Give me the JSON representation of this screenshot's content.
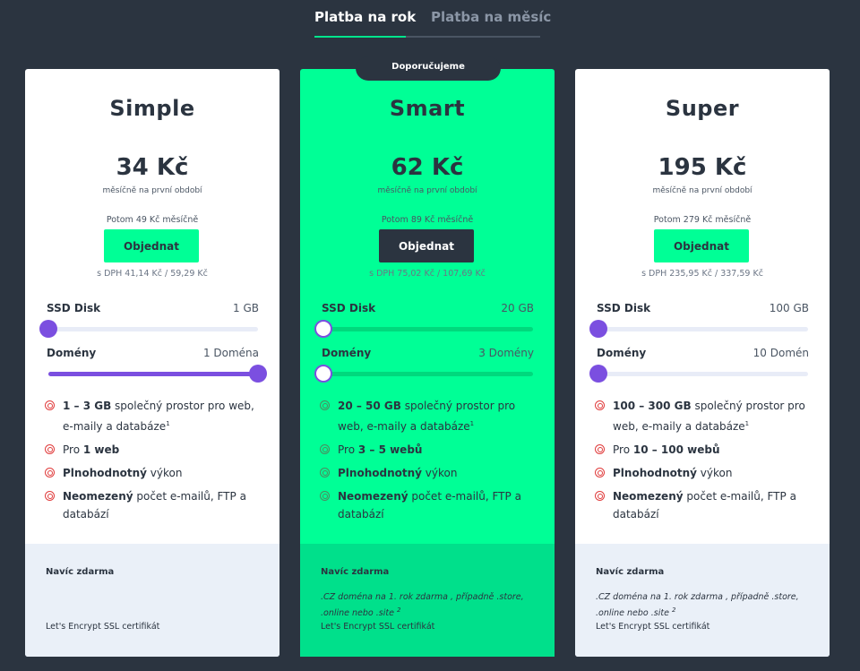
{
  "billing_tabs": {
    "active": "Platba na rok",
    "inactive": "Platba na měsíc"
  },
  "badge": "Doporučujeme",
  "plans": [
    {
      "name": "Simple",
      "price": "34 Kč",
      "price_note": "měsíčně na první období",
      "then": "Potom 49 Kč měsíčně",
      "order": "Objednat",
      "vat": "s DPH 41,14 Kč / 59,29 Kč",
      "ssd_label": "SSD Disk",
      "ssd_value": "1 GB",
      "ssd_level": 0,
      "domains_label": "Domény",
      "domains_value": "1 Doména",
      "domains_level": 1,
      "features": [
        {
          "bold": "1 – 3 GB",
          "text": " společný prostor pro web, e-maily a databáze",
          "sup": "1"
        },
        {
          "pre": "Pro ",
          "bold": "1 web"
        },
        {
          "bold": "Plnohodnotný",
          "text": " výkon"
        },
        {
          "bold": "Neomezený",
          "text": " počet e-mailů, FTP a databází"
        }
      ],
      "extras_title": "Navíc zdarma",
      "extras_domain": "",
      "extras_ssl": "Let's Encrypt SSL certifikát"
    },
    {
      "name": "Smart",
      "price": "62 Kč",
      "price_note": "měsíčně na první období",
      "then": "Potom 89 Kč měsíčně",
      "order": "Objednat",
      "vat": "s DPH 75,02 Kč / 107,69 Kč",
      "ssd_label": "SSD Disk",
      "ssd_value": "20 GB",
      "ssd_level": 0,
      "domains_label": "Domény",
      "domains_value": "3 Domény",
      "domains_level": 0,
      "features": [
        {
          "bold": "20 – 50 GB",
          "text": " společný prostor pro web, e-maily a databáze",
          "sup": "1"
        },
        {
          "pre": "Pro ",
          "bold": "3 – 5 webů"
        },
        {
          "bold": "Plnohodnotný",
          "text": " výkon"
        },
        {
          "bold": "Neomezený",
          "text": " počet e-mailů, FTP a databází"
        }
      ],
      "extras_title": "Navíc zdarma",
      "extras_domain": ".CZ doména na 1. rok zdarma , případně .store, .online nebo .site",
      "extras_domain_sup": "2",
      "extras_ssl": "Let's Encrypt SSL certifikát"
    },
    {
      "name": "Super",
      "price": "195 Kč",
      "price_note": "měsíčně na první období",
      "then": "Potom 279 Kč měsíčně",
      "order": "Objednat",
      "vat": "s DPH 235,95 Kč / 337,59 Kč",
      "ssd_label": "SSD Disk",
      "ssd_value": "100 GB",
      "ssd_level": 0,
      "domains_label": "Domény",
      "domains_value": "10 Domén",
      "domains_level": 0,
      "features": [
        {
          "bold": "100 – 300 GB",
          "text": " společný prostor pro web, e-maily a databáze",
          "sup": "1"
        },
        {
          "pre": "Pro ",
          "bold": "10 – 100 webů"
        },
        {
          "bold": "Plnohodnotný",
          "text": " výkon"
        },
        {
          "bold": "Neomezený",
          "text": " počet e-mailů, FTP a databází"
        }
      ],
      "extras_title": "Navíc zdarma",
      "extras_domain": ".CZ doména na 1. rok zdarma , případně .store, .online nebo .site",
      "extras_domain_sup": "2",
      "extras_ssl": "Let's Encrypt SSL certifikát"
    }
  ],
  "colors": {
    "background": "#2b3440",
    "accent_green": "#00ff96",
    "slider_purple": "#7b4fe0",
    "bullet_red": "#e03c3c"
  },
  "icons": {
    "feature_bullet": "target-icon"
  }
}
